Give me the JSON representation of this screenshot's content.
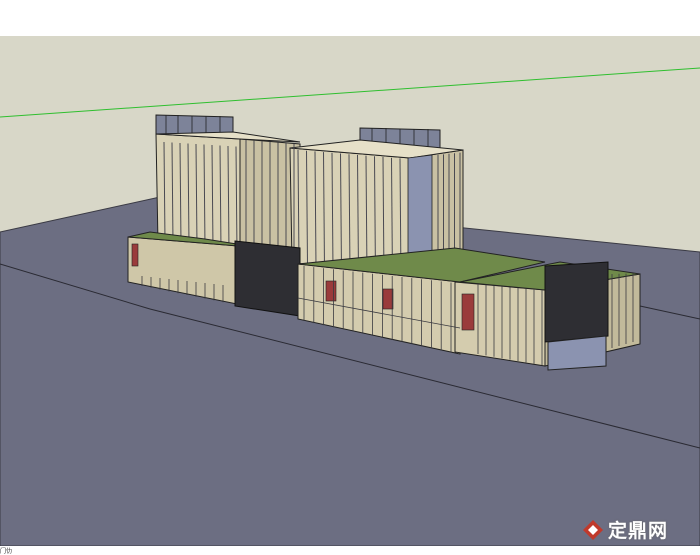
{
  "viewport": {
    "sky_color": "#d8d7c8",
    "ground_color": "#6c6e82",
    "horizon_axis_color": "#2fbf2f",
    "edge_color": "#1a1a1a"
  },
  "model": {
    "tower_color": "#d9d2b6",
    "glass_color": "#8b93b0",
    "podium_color": "#cfc7a8",
    "roof_color": "#6f8a4a",
    "dark_facade_color": "#2e2e33",
    "accent_red": "#9a3b3b"
  },
  "watermark": {
    "text": "定鼎网",
    "icon": "ddove-logo-icon",
    "color": "#c0392b"
  },
  "statusbar": {
    "left_text": "门仂"
  }
}
